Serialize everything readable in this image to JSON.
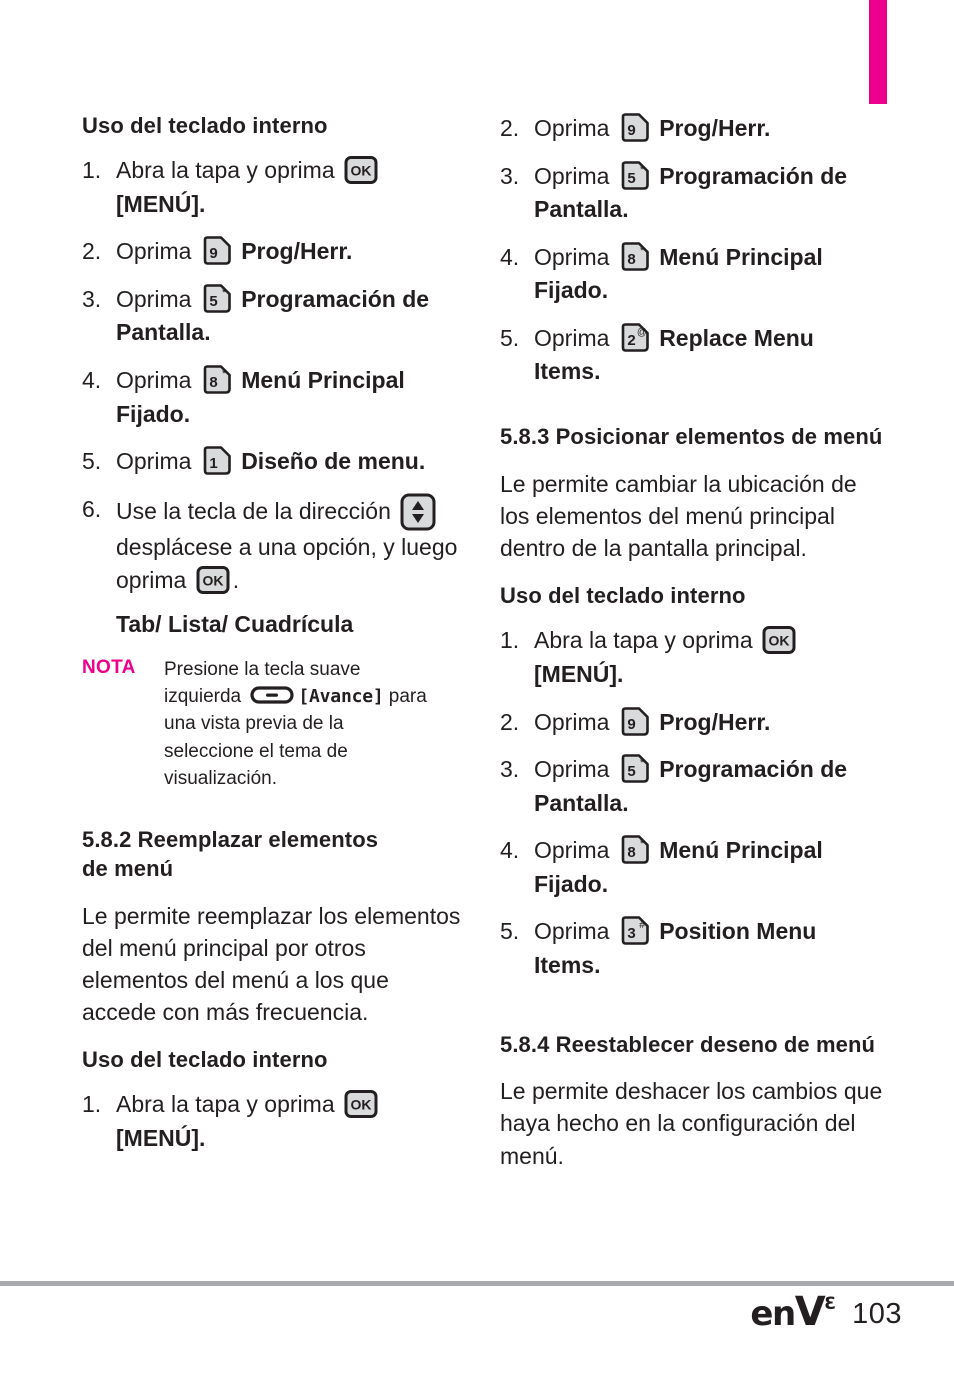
{
  "colors": {
    "magenta": "#ec008c",
    "text": "#231f20",
    "rule": "#a7a9ac",
    "key_fill": "#d9dadb"
  },
  "tab_marker": {
    "name": "section-tab-marker"
  },
  "left_column": {
    "heading_1": "Uso del teclado interno",
    "steps_1": [
      {
        "num": "1.",
        "text": "Abra la tapa y oprima",
        "key": "OK",
        "key_type": "ok",
        "after": "",
        "cont": "[MENÚ]."
      },
      {
        "num": "2.",
        "text": "Oprima",
        "key": "9",
        "key_sup": "'",
        "key_type": "num",
        "bold_after": "Prog/Herr."
      },
      {
        "num": "3.",
        "text": "Oprima",
        "key": "5",
        "key_sup": "*",
        "key_type": "num",
        "bold_after": "Programación de",
        "cont": "Pantalla."
      },
      {
        "num": "4.",
        "text": "Oprima",
        "key": "8",
        "key_sup": "*",
        "key_type": "num",
        "bold_after": "Menú Principal",
        "cont": "Fijado."
      },
      {
        "num": "5.",
        "text": "Oprima",
        "key": "1",
        "key_sup": "'",
        "key_type": "num",
        "bold_after": "Diseño de menu."
      },
      {
        "num": "6.",
        "text": "Use la tecla de la dirección",
        "key_type": "dir",
        "cont2": "desplácese a una opción, y luego",
        "cont3_pre": "oprima",
        "cont3_post": ".",
        "sub_bold": "Tab/ Lista/ Cuadrícula"
      }
    ],
    "nota": {
      "label": "NOTA",
      "line1": "Presione la tecla suave",
      "line2_pre": "izquierda",
      "line2_mono": "[Avance]",
      "line2_post": "para",
      "line3": "una vista previa de la",
      "line4": "seleccione el tema de",
      "line5": "visualización."
    },
    "section_582": {
      "heading_line1": "5.8.2 Reemplazar elementos",
      "heading_line2": "de menú",
      "body": "Le permite reemplazar los elementos del menú principal por otros elementos del menú a los que accede con más frecuencia.",
      "subheading": "Uso del teclado interno",
      "step_1_num": "1.",
      "step_1_text": "Abra la tapa y oprima",
      "step_1_key": "OK",
      "step_1_cont": "[MENÚ]."
    }
  },
  "right_column": {
    "steps_cont": [
      {
        "num": "2.",
        "text": "Oprima",
        "key": "9",
        "key_sup": "'",
        "key_type": "num",
        "bold_after": "Prog/Herr."
      },
      {
        "num": "3.",
        "text": "Oprima",
        "key": "5",
        "key_sup": "*",
        "key_type": "num",
        "bold_after": "Programación de",
        "cont": "Pantalla."
      },
      {
        "num": "4.",
        "text": "Oprima",
        "key": "8",
        "key_sup": "*",
        "key_type": "num",
        "bold_after": "Menú Principal",
        "cont": "Fijado."
      },
      {
        "num": "5.",
        "text": "Oprima",
        "key": "2",
        "key_sup": "@",
        "key_type": "num",
        "bold_after": "Replace Menu",
        "cont": "Items."
      }
    ],
    "section_583": {
      "heading": "5.8.3 Posicionar elementos de menú",
      "body": "Le permite cambiar la ubicación de los elementos del menú principal dentro de la pantalla principal.",
      "subheading": "Uso del teclado interno",
      "steps": [
        {
          "num": "1.",
          "text": "Abra la tapa y oprima",
          "key": "OK",
          "key_type": "ok",
          "cont": "[MENÚ]."
        },
        {
          "num": "2.",
          "text": "Oprima",
          "key": "9",
          "key_sup": "'",
          "key_type": "num",
          "bold_after": "Prog/Herr."
        },
        {
          "num": "3.",
          "text": "Oprima",
          "key": "5",
          "key_sup": "*",
          "key_type": "num",
          "bold_after": "Programación de",
          "cont": "Pantalla."
        },
        {
          "num": "4.",
          "text": "Oprima",
          "key": "8",
          "key_sup": "*",
          "key_type": "num",
          "bold_after": "Menú Principal",
          "cont": "Fijado."
        },
        {
          "num": "5.",
          "text": "Oprima",
          "key": "3",
          "key_sup": "#",
          "key_type": "num",
          "bold_after": "Position Menu",
          "cont": "Items."
        }
      ]
    },
    "section_584": {
      "heading": "5.8.4 Reestablecer deseno de menú",
      "body": "Le permite deshacer los cambios que haya hecho en la configuración del menú."
    }
  },
  "footer": {
    "logo_en": "en",
    "logo_v": "V",
    "logo_sup": "3",
    "page_number": "103"
  }
}
